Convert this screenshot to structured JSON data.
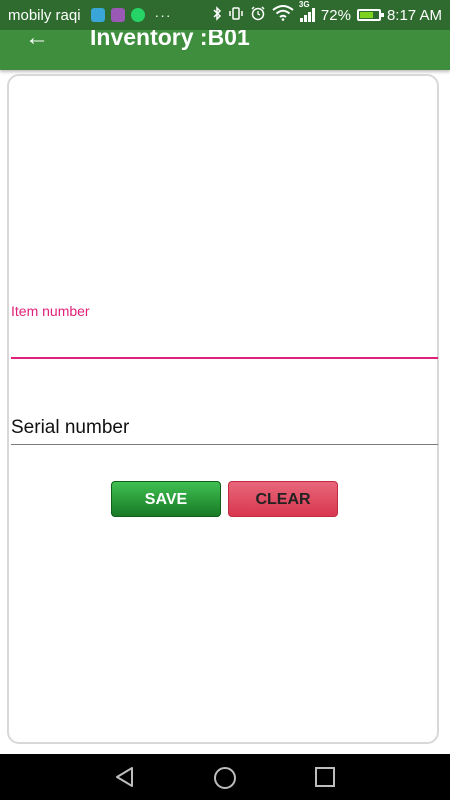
{
  "status_bar": {
    "carrier": "mobily raqi",
    "more_indicator": "···",
    "network_type": "3G",
    "battery_percent": "72%",
    "battery_level": 0.72,
    "time": "8:17 AM",
    "icons": [
      "bluetooth-icon",
      "vibrate-icon",
      "alarm-icon",
      "wifi-icon",
      "signal-icon",
      "battery-charging-icon"
    ],
    "app_icon_colors": [
      "#3aa6d8",
      "#9b59b6",
      "#25d366"
    ]
  },
  "app_bar": {
    "title": "Inventory :B01",
    "back_icon": "arrow-left-icon",
    "color": "#3e8e3e"
  },
  "form": {
    "item_number": {
      "label": "Item number",
      "value": "",
      "accent_color": "#e0207a"
    },
    "serial_number": {
      "placeholder": "Serial number",
      "value": ""
    },
    "save_label": "SAVE",
    "clear_label": "CLEAR"
  },
  "nav_bar": {
    "icons": [
      "back-triangle-icon",
      "home-circle-icon",
      "recents-square-icon"
    ]
  }
}
